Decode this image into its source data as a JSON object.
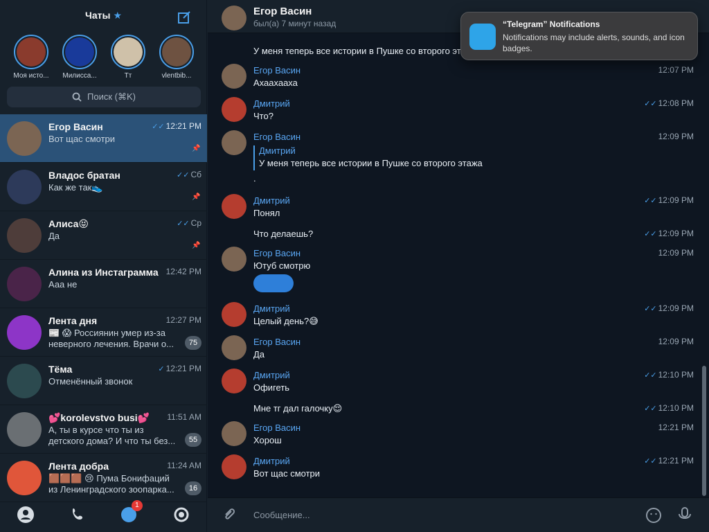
{
  "sidebar": {
    "title": "Чаты",
    "stories": [
      {
        "name": "Моя исто...",
        "color": "#8a3b2d"
      },
      {
        "name": "Милисса...",
        "color": "#193a9a"
      },
      {
        "name": "Тт",
        "color": "#cfc1a9"
      },
      {
        "name": "vlentbib...",
        "color": "#6e5241"
      }
    ],
    "search_placeholder": "Поиск (⌘K)",
    "chats": [
      {
        "name": "Егор Васин",
        "time": "12:21 PM",
        "preview": "Вот щас смотри",
        "pinned": true,
        "read": true,
        "avatar_color": "#7b6553"
      },
      {
        "name": "Владос братан",
        "time": "Сб",
        "preview": "Как же так👟",
        "pinned": true,
        "read": true,
        "avatar_color": "#2d3a5a"
      },
      {
        "name": "Алиса😝",
        "time": "Ср",
        "preview": "Да",
        "pinned": true,
        "read": true,
        "avatar_color": "#4e3d3a"
      },
      {
        "name": "Алина из Инстаграмма",
        "time": "12:42 PM",
        "preview": "Ааа не",
        "avatar_color": "#4a2449"
      },
      {
        "name": "Лента дня",
        "time": "12:27 PM",
        "preview": "📰 😱 Россиянин умер из-за неверного лечения. Врачи о...",
        "badge": "75",
        "avatar_color": "#8d35c7"
      },
      {
        "name": "Тёма",
        "time": "12:21 PM",
        "preview": "Отменённый звонок",
        "read": true,
        "avatar_color": "#2c4a4f"
      },
      {
        "name": "💕korolevstvo busi💕",
        "time": "11:51 AM",
        "preview": "А, ты в курсе что ты из детского дома? И что ты без...",
        "badge": "55",
        "avatar_color": "#6a6f73"
      },
      {
        "name": "Лента добра",
        "time": "11:24 AM",
        "preview": "🟫🟫🟫 😢 Пума Бонифаций из Ленинградского зоопарка...",
        "badge": "16",
        "avatar_color": "#e0563a"
      }
    ],
    "nav_badge": "1"
  },
  "chat": {
    "name": "Егор Васин",
    "status": "был(а) 7 минут назад",
    "top_text": "У меня теперь все истории в Пушке со второго этажа",
    "messages": [
      {
        "author": "Егор Васин",
        "text": "Ахаахааха",
        "time": "12:07 PM"
      },
      {
        "author": "Дмитрий",
        "text": "Что?",
        "time": "12:08 PM"
      },
      {
        "author": "Егор Васин",
        "reply_author": "Дмитрий",
        "reply_text": "У меня теперь все истории в Пушке со второго этажа",
        "text": ".",
        "time": "12:09 PM"
      },
      {
        "author": "Дмитрий",
        "text": "Понял",
        "time": "12:09 PM"
      },
      {
        "text": "Что делаешь?",
        "time": "12:09 PM"
      },
      {
        "author": "Егор Васин",
        "text": "Ютуб смотрю",
        "time": "12:09 PM"
      },
      {
        "author": "Дмитрий",
        "text": "Целый день?😅",
        "time": "12:09 PM"
      },
      {
        "author": "Егор Васин",
        "text": "Да",
        "time": "12:09 PM"
      },
      {
        "author": "Дмитрий",
        "text": "Офигеть",
        "time": "12:10 PM"
      },
      {
        "text": "Мне тг дал галочку😌",
        "time": "12:10 PM"
      },
      {
        "author": "Егор Васин",
        "text": "Хорош",
        "time": "12:21 PM"
      },
      {
        "author": "Дмитрий",
        "text": "Вот щас смотри",
        "time": "12:21 PM"
      }
    ],
    "composer_placeholder": "Сообщение..."
  },
  "notification": {
    "title": "“Telegram” Notifications",
    "body": "Notifications may include alerts, sounds, and icon badges."
  }
}
